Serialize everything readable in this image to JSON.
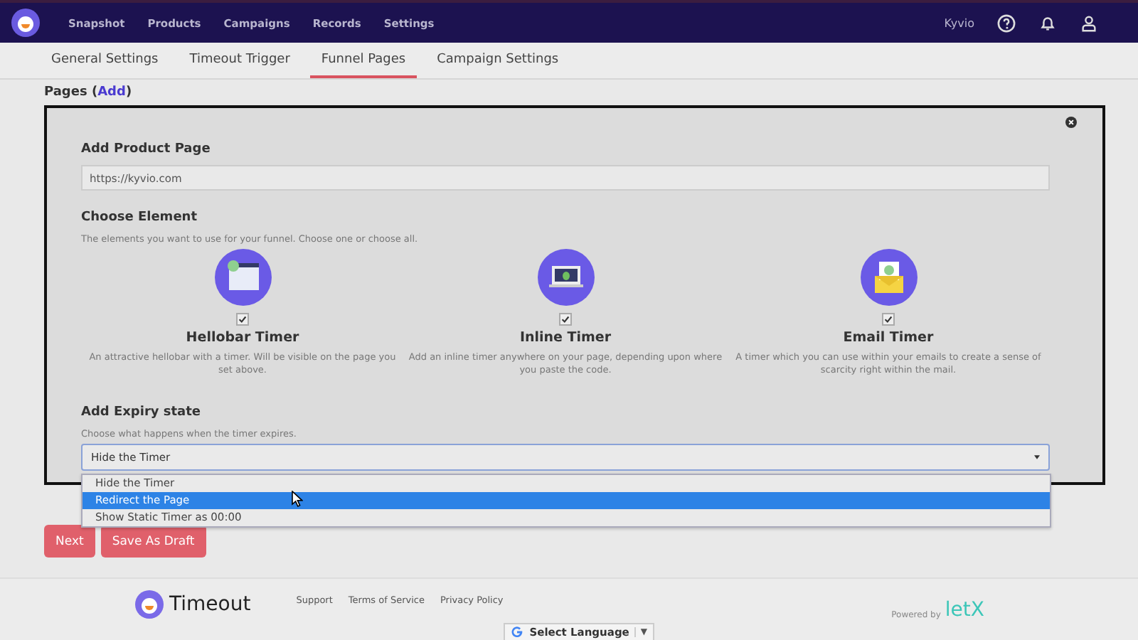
{
  "nav": {
    "items": [
      "Snapshot",
      "Products",
      "Campaigns",
      "Records",
      "Settings"
    ],
    "user": "Kyvio"
  },
  "tabs": [
    {
      "label": "General Settings",
      "selected": false
    },
    {
      "label": "Timeout Trigger",
      "selected": false
    },
    {
      "label": "Funnel Pages",
      "selected": true
    },
    {
      "label": "Campaign Settings",
      "selected": false
    }
  ],
  "pages_heading": {
    "label": "Pages (",
    "link": "Add",
    "close": ")"
  },
  "product_page": {
    "title": "Add Product Page",
    "value": "https://kyvio.com"
  },
  "choose_element": {
    "title": "Choose Element",
    "hint": "The elements you want to use for your funnel. Choose one or choose all."
  },
  "elements": [
    {
      "kind": "hellobar",
      "name": "Hellobar Timer",
      "checked": true,
      "description": "An attractive hellobar with a timer. Will be visible on the page you set above."
    },
    {
      "kind": "inline",
      "name": "Inline Timer",
      "checked": true,
      "description": "Add an inline timer anywhere on your page, depending upon where you paste the code."
    },
    {
      "kind": "email",
      "name": "Email Timer",
      "checked": true,
      "description": "A timer which you can use within your emails to create a sense of scarcity right within the mail."
    }
  ],
  "expiry": {
    "title": "Add Expiry state",
    "hint": "Choose what happens when the timer expires.",
    "value": "Hide the Timer",
    "options": [
      {
        "label": "Hide the Timer",
        "highlighted": false
      },
      {
        "label": "Redirect the Page",
        "highlighted": true
      },
      {
        "label": "Show Static Timer as 00:00",
        "highlighted": false
      }
    ]
  },
  "buttons": [
    "Next",
    "Save As Draft"
  ],
  "footer": {
    "brand": "Timeout",
    "links": [
      "Support",
      "Terms of Service",
      "Privacy Policy"
    ],
    "powered": "Powered by",
    "powered_brand": "letX",
    "language": "Select Language",
    "language_caret": "▼"
  }
}
